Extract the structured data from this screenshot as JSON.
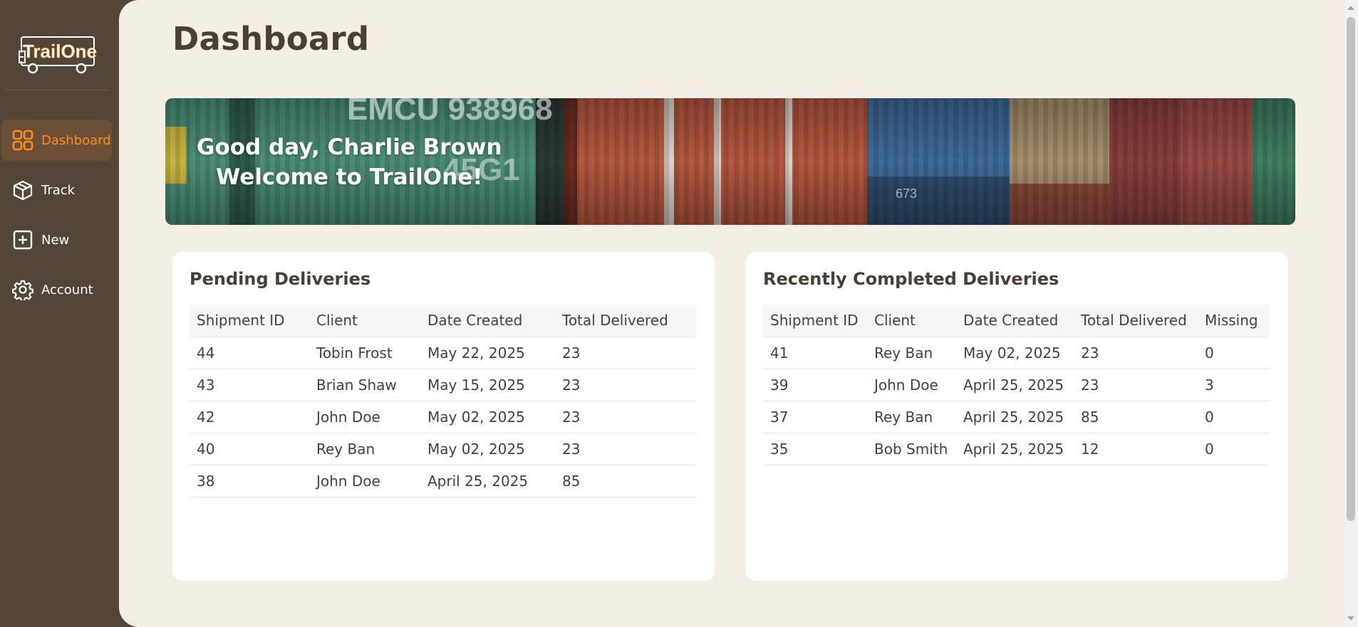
{
  "brand": {
    "logo_text": "TrailOne"
  },
  "sidebar": {
    "items": [
      {
        "label": "Dashboard",
        "icon": "dashboard-grid-icon",
        "active": true
      },
      {
        "label": "Track",
        "icon": "box-icon",
        "active": false
      },
      {
        "label": "New",
        "icon": "plus-square-icon",
        "active": false
      },
      {
        "label": "Account",
        "icon": "gear-icon",
        "active": false
      }
    ]
  },
  "page": {
    "title": "Dashboard"
  },
  "banner": {
    "greeting": "Good day, Charlie Brown",
    "welcome": "Welcome to TrailOne!"
  },
  "pending": {
    "title": "Pending Deliveries",
    "columns": [
      "Shipment ID",
      "Client",
      "Date Created",
      "Total Delivered"
    ],
    "rows": [
      [
        "44",
        "Tobin Frost",
        "May 22, 2025",
        "23"
      ],
      [
        "43",
        "Brian Shaw",
        "May 15, 2025",
        "23"
      ],
      [
        "42",
        "John Doe",
        "May 02, 2025",
        "23"
      ],
      [
        "40",
        "Rey Ban",
        "May 02, 2025",
        "23"
      ],
      [
        "38",
        "John Doe",
        "April 25, 2025",
        "85"
      ]
    ]
  },
  "completed": {
    "title": "Recently Completed Deliveries",
    "columns": [
      "Shipment ID",
      "Client",
      "Date Created",
      "Total Delivered",
      "Missing"
    ],
    "rows": [
      [
        "41",
        "Rey Ban",
        "May 02, 2025",
        "23",
        "0"
      ],
      [
        "39",
        "John Doe",
        "April 25, 2025",
        "23",
        "3"
      ],
      [
        "37",
        "Rey Ban",
        "April 25, 2025",
        "85",
        "0"
      ],
      [
        "35",
        "Bob Smith",
        "April 25, 2025",
        "12",
        "0"
      ]
    ]
  },
  "colors": {
    "sidebar_bg": "#534638",
    "main_bg": "#f4efe5",
    "accent": "#ff8d1f",
    "active_bg": "#6b4f36",
    "text": "#4a3f35"
  }
}
